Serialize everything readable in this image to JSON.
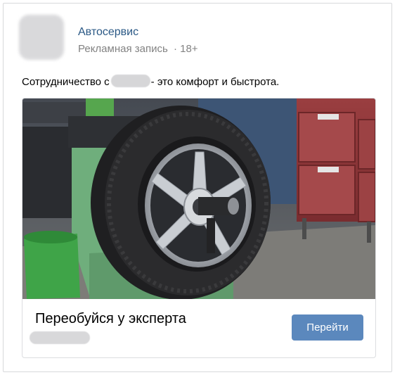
{
  "post": {
    "author": "Автосервис",
    "label": "Рекламная запись",
    "age_rating": "· 18+",
    "text_before": "Сотрудничество с",
    "text_after": "- это комфорт и быстрота."
  },
  "card": {
    "title": "Переобуйся у эксперта",
    "button_label": "Перейти"
  },
  "colors": {
    "link": "#2a5885",
    "secondary": "#828282",
    "button": "#5b88bd"
  }
}
